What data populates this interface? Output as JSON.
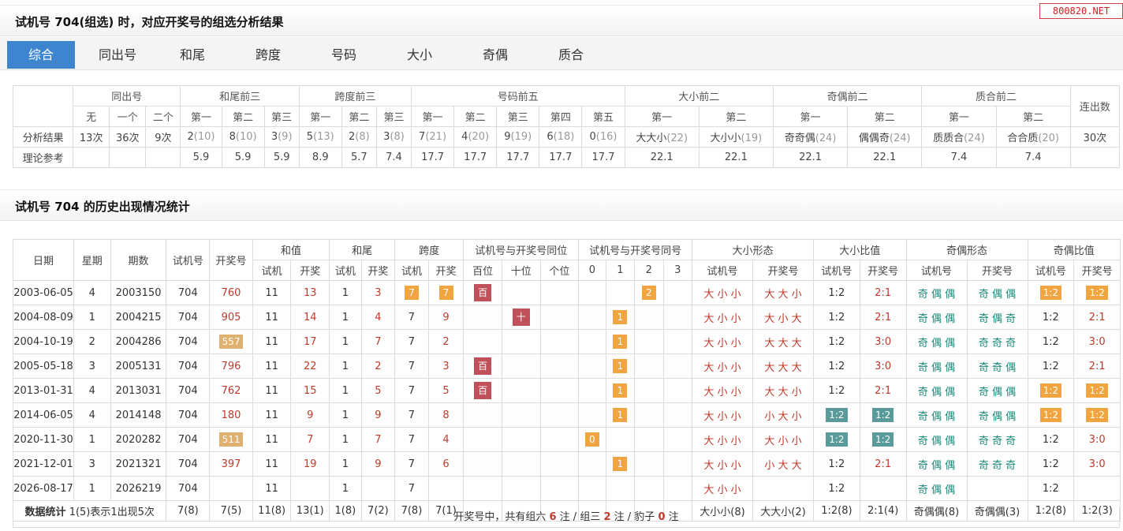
{
  "section1": {
    "title": "试机号 704(组选) 时，对应开奖号的组选分析结果"
  },
  "watermark": "800820.NET",
  "tabs": [
    "综合",
    "同出号",
    "和尾",
    "跨度",
    "号码",
    "大小",
    "奇偶",
    "质合"
  ],
  "summary": {
    "groups": [
      "同出号",
      "和尾前三",
      "跨度前三",
      "号码前五",
      "大小前二",
      "奇偶前二",
      "质合前二",
      "连出数"
    ],
    "subheaders": [
      "无",
      "一个",
      "二个",
      "第一",
      "第二",
      "第三",
      "第一",
      "第二",
      "第三",
      "第一",
      "第二",
      "第三",
      "第四",
      "第五",
      "第一",
      "第二",
      "第一",
      "第二",
      "第一",
      "第二"
    ],
    "row_labels": [
      "分析结果",
      "理论参考"
    ],
    "result": [
      {
        "v": "13次",
        "s": ""
      },
      {
        "v": "36次",
        "s": ""
      },
      {
        "v": "9次",
        "s": ""
      },
      {
        "v": "2",
        "s": "(10)"
      },
      {
        "v": "8",
        "s": "(10)"
      },
      {
        "v": "3",
        "s": "(9)"
      },
      {
        "v": "5",
        "s": "(13)"
      },
      {
        "v": "2",
        "s": "(8)"
      },
      {
        "v": "3",
        "s": "(8)"
      },
      {
        "v": "7",
        "s": "(21)"
      },
      {
        "v": "4",
        "s": "(20)"
      },
      {
        "v": "9",
        "s": "(19)"
      },
      {
        "v": "6",
        "s": "(18)"
      },
      {
        "v": "0",
        "s": "(16)"
      },
      {
        "v": "大大小",
        "s": "(22)"
      },
      {
        "v": "大小小",
        "s": "(19)"
      },
      {
        "v": "奇奇偶",
        "s": "(24)"
      },
      {
        "v": "偶偶奇",
        "s": "(24)"
      },
      {
        "v": "质质合",
        "s": "(24)"
      },
      {
        "v": "合合质",
        "s": "(20)"
      },
      {
        "v": "30次",
        "s": ""
      }
    ],
    "reference": [
      "",
      "",
      "",
      "5.9",
      "5.9",
      "5.9",
      "8.9",
      "5.7",
      "7.4",
      "17.7",
      "17.7",
      "17.7",
      "17.7",
      "17.7",
      "22.1",
      "22.1",
      "22.1",
      "22.1",
      "7.4",
      "7.4",
      ""
    ]
  },
  "section2": {
    "title": "试机号 704 的历史出现情况统计"
  },
  "history": {
    "headers_top": [
      "日期",
      "星期",
      "期数",
      "试机号",
      "开奖号",
      "和值",
      "和尾",
      "跨度",
      "试机号与开奖号同位",
      "试机号与开奖号同号",
      "大小形态",
      "大小比值",
      "奇偶形态",
      "奇偶比值"
    ],
    "headers_sub": [
      "试机",
      "开奖",
      "试机",
      "开奖",
      "试机",
      "开奖",
      "百位",
      "十位",
      "个位",
      "0",
      "1",
      "2",
      "3",
      "试机号",
      "开奖号",
      "试机号",
      "开奖号",
      "试机号",
      "开奖号",
      "试机号",
      "开奖号"
    ],
    "rows": [
      {
        "date": "2003-06-05",
        "week": "4",
        "issue": "2003150",
        "test": "704",
        "draw": "760",
        "draw_hl": false,
        "sum_t": "11",
        "sum_d": "13",
        "tail_t": "1",
        "tail_d": "3",
        "span_t": "7",
        "span_d": "7",
        "span_hl": true,
        "pos": "百",
        "pos_col": 0,
        "same_col": 2,
        "same_v": "2",
        "bs_t": "大小小",
        "bs_d": "大大小",
        "bsr_t": "1:2",
        "bsr_d": "2:1",
        "bsr_hl": false,
        "oe_t": "奇偶偶",
        "oe_d": "奇偶偶",
        "oer_t": "1:2",
        "oer_d": "1:2",
        "oer_hl": true
      },
      {
        "date": "2004-08-09",
        "week": "1",
        "issue": "2004215",
        "test": "704",
        "draw": "905",
        "draw_hl": false,
        "sum_t": "11",
        "sum_d": "14",
        "tail_t": "1",
        "tail_d": "4",
        "span_t": "7",
        "span_d": "9",
        "span_hl": false,
        "pos": "十",
        "pos_col": 1,
        "same_col": 1,
        "same_v": "1",
        "bs_t": "大小小",
        "bs_d": "大小大",
        "bsr_t": "1:2",
        "bsr_d": "2:1",
        "bsr_hl": false,
        "oe_t": "奇偶偶",
        "oe_d": "奇偶奇",
        "oer_t": "1:2",
        "oer_d": "2:1",
        "oer_hl": false
      },
      {
        "date": "2004-10-19",
        "week": "2",
        "issue": "2004286",
        "test": "704",
        "draw": "557",
        "draw_hl": true,
        "sum_t": "11",
        "sum_d": "17",
        "tail_t": "1",
        "tail_d": "7",
        "span_t": "7",
        "span_d": "2",
        "span_hl": false,
        "pos": "",
        "pos_col": -1,
        "same_col": 1,
        "same_v": "1",
        "bs_t": "大小小",
        "bs_d": "大大大",
        "bsr_t": "1:2",
        "bsr_d": "3:0",
        "bsr_hl": false,
        "oe_t": "奇偶偶",
        "oe_d": "奇奇奇",
        "oer_t": "1:2",
        "oer_d": "3:0",
        "oer_hl": false
      },
      {
        "date": "2005-05-18",
        "week": "3",
        "issue": "2005131",
        "test": "704",
        "draw": "796",
        "draw_hl": false,
        "sum_t": "11",
        "sum_d": "22",
        "tail_t": "1",
        "tail_d": "2",
        "span_t": "7",
        "span_d": "3",
        "span_hl": false,
        "pos": "百",
        "pos_col": 0,
        "same_col": 1,
        "same_v": "1",
        "bs_t": "大小小",
        "bs_d": "大大大",
        "bsr_t": "1:2",
        "bsr_d": "3:0",
        "bsr_hl": false,
        "oe_t": "奇偶偶",
        "oe_d": "奇奇偶",
        "oer_t": "1:2",
        "oer_d": "2:1",
        "oer_hl": false
      },
      {
        "date": "2013-01-31",
        "week": "4",
        "issue": "2013031",
        "test": "704",
        "draw": "762",
        "draw_hl": false,
        "sum_t": "11",
        "sum_d": "15",
        "tail_t": "1",
        "tail_d": "5",
        "span_t": "7",
        "span_d": "5",
        "span_hl": false,
        "pos": "百",
        "pos_col": 0,
        "same_col": 1,
        "same_v": "1",
        "bs_t": "大小小",
        "bs_d": "大大小",
        "bsr_t": "1:2",
        "bsr_d": "2:1",
        "bsr_hl": false,
        "oe_t": "奇偶偶",
        "oe_d": "奇偶偶",
        "oer_t": "1:2",
        "oer_d": "1:2",
        "oer_hl": true
      },
      {
        "date": "2014-06-05",
        "week": "4",
        "issue": "2014148",
        "test": "704",
        "draw": "180",
        "draw_hl": false,
        "sum_t": "11",
        "sum_d": "9",
        "tail_t": "1",
        "tail_d": "9",
        "span_t": "7",
        "span_d": "8",
        "span_hl": false,
        "pos": "",
        "pos_col": -1,
        "same_col": 1,
        "same_v": "1",
        "bs_t": "大小小",
        "bs_d": "小大小",
        "bsr_t": "1:2",
        "bsr_d": "1:2",
        "bsr_hl": true,
        "oe_t": "奇偶偶",
        "oe_d": "奇偶偶",
        "oer_t": "1:2",
        "oer_d": "1:2",
        "oer_hl": true
      },
      {
        "date": "2020-11-30",
        "week": "1",
        "issue": "2020282",
        "test": "704",
        "draw": "511",
        "draw_hl": true,
        "sum_t": "11",
        "sum_d": "7",
        "tail_t": "1",
        "tail_d": "7",
        "span_t": "7",
        "span_d": "4",
        "span_hl": false,
        "pos": "",
        "pos_col": -1,
        "same_col": 0,
        "same_v": "0",
        "bs_t": "大小小",
        "bs_d": "大小小",
        "bsr_t": "1:2",
        "bsr_d": "1:2",
        "bsr_hl": true,
        "oe_t": "奇偶偶",
        "oe_d": "奇奇奇",
        "oer_t": "1:2",
        "oer_d": "3:0",
        "oer_hl": false
      },
      {
        "date": "2021-12-01",
        "week": "3",
        "issue": "2021321",
        "test": "704",
        "draw": "397",
        "draw_hl": false,
        "sum_t": "11",
        "sum_d": "19",
        "tail_t": "1",
        "tail_d": "9",
        "span_t": "7",
        "span_d": "6",
        "span_hl": false,
        "pos": "",
        "pos_col": -1,
        "same_col": 1,
        "same_v": "1",
        "bs_t": "大小小",
        "bs_d": "小大大",
        "bsr_t": "1:2",
        "bsr_d": "2:1",
        "bsr_hl": false,
        "oe_t": "奇偶偶",
        "oe_d": "奇奇奇",
        "oer_t": "1:2",
        "oer_d": "3:0",
        "oer_hl": false
      },
      {
        "date": "2026-08-17",
        "week": "1",
        "issue": "2026219",
        "test": "704",
        "draw": "",
        "draw_hl": false,
        "sum_t": "11",
        "sum_d": "",
        "tail_t": "1",
        "tail_d": "",
        "span_t": "7",
        "span_d": "",
        "span_hl": false,
        "pos": "",
        "pos_col": -1,
        "same_col": -1,
        "same_v": "",
        "bs_t": "大小小",
        "bs_d": "",
        "bsr_t": "1:2",
        "bsr_d": "",
        "bsr_hl": false,
        "oe_t": "奇偶偶",
        "oe_d": "",
        "oer_t": "1:2",
        "oer_d": "",
        "oer_hl": false
      }
    ],
    "stats": {
      "label": "数据统计",
      "note": "1(5)表示1出现5次",
      "cells": [
        "7(8)",
        "7(5)",
        "11(8)",
        "13(1)",
        "1(8)",
        "7(2)",
        "7(8)",
        "7(1)",
        "",
        "",
        "",
        "",
        "",
        "",
        "",
        "大小小(8)",
        "大大小(2)",
        "1:2(8)",
        "2:1(4)",
        "奇偶偶(8)",
        "奇偶偶(3)",
        "1:2(8)",
        "1:2(3)"
      ]
    },
    "footer": {
      "prefix": "开奖号中，共有组六",
      "g6": "6",
      "mid1": "注 / 组三",
      "g3": "2",
      "mid2": "注 / 豹子",
      "bz": "0",
      "suffix": "注"
    }
  }
}
